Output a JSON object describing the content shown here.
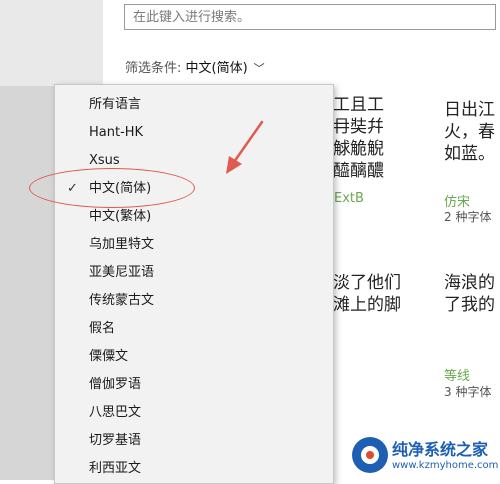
{
  "search": {
    "placeholder": "在此键入进行搜索。"
  },
  "filter": {
    "label": "筛选条件: ",
    "value": "中文(简体)"
  },
  "cards": [
    {
      "preview": "工且工\n冄奘幷\n觩觤觬\n醯醨醲",
      "name": "ExtB",
      "count": ""
    },
    {
      "preview": "日出江\n火，春\n如蓝。",
      "name": "仿宋",
      "count": "2 种字体"
    },
    {
      "preview": "淡了他们\n滩上的脚",
      "name": "",
      "count": ""
    },
    {
      "preview": "海浪的\n了我的",
      "name": "等线",
      "count": "3 种字体"
    }
  ],
  "menu": {
    "items": [
      {
        "label": "所有语言",
        "checked": false
      },
      {
        "label": "Hant-HK",
        "checked": false
      },
      {
        "label": "Xsus",
        "checked": false
      },
      {
        "label": "中文(简体)",
        "checked": true
      },
      {
        "label": "中文(繁体)",
        "checked": false
      },
      {
        "label": "乌加里特文",
        "checked": false
      },
      {
        "label": "亚美尼亚语",
        "checked": false
      },
      {
        "label": "传统蒙古文",
        "checked": false
      },
      {
        "label": "假名",
        "checked": false
      },
      {
        "label": "傈僳文",
        "checked": false
      },
      {
        "label": "僧伽罗语",
        "checked": false
      },
      {
        "label": "八思巴文",
        "checked": false
      },
      {
        "label": "切罗基语",
        "checked": false
      },
      {
        "label": "利西亚文",
        "checked": false
      }
    ],
    "check_glyph": "✓"
  },
  "filter_chevron": "﹀",
  "watermark": {
    "title": "纯净系统之家",
    "url": "www.kzmyhome.com"
  },
  "colors": {
    "annotation": "#e05a4f",
    "accent_green": "#6aa84f",
    "brand_blue": "#1e5fb4"
  }
}
